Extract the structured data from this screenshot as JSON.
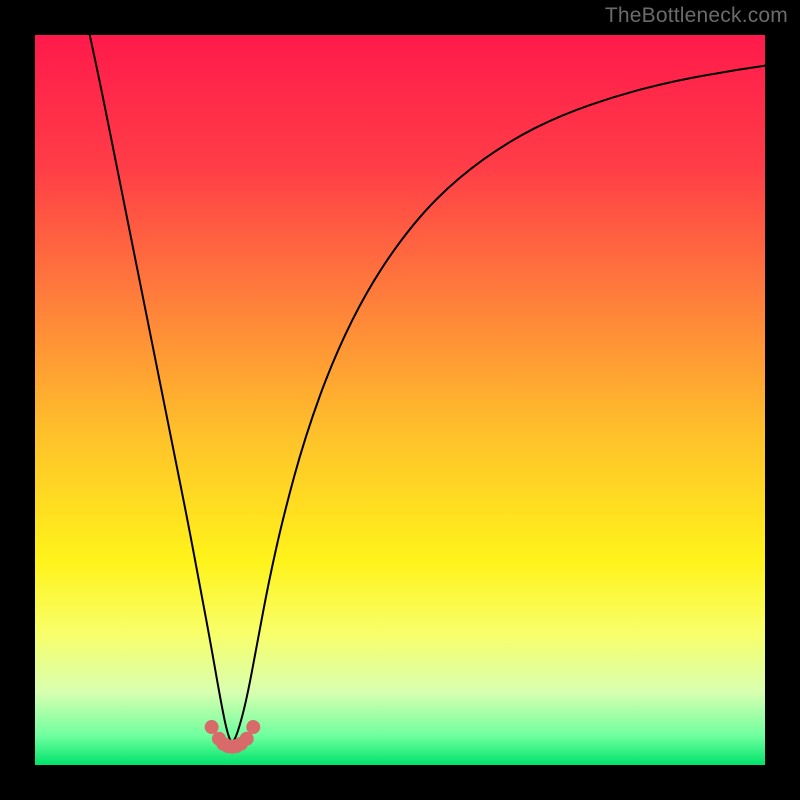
{
  "watermark": "TheBottleneck.com",
  "chart_data": {
    "type": "line",
    "title": "",
    "xlabel": "",
    "ylabel": "",
    "xlim": [
      0,
      100
    ],
    "ylim": [
      0,
      100
    ],
    "grid": false,
    "legend": false,
    "background_gradient": {
      "stops": [
        {
          "offset": 0.0,
          "color": "#ff1a4b"
        },
        {
          "offset": 0.18,
          "color": "#ff3d47"
        },
        {
          "offset": 0.35,
          "color": "#ff7a3c"
        },
        {
          "offset": 0.55,
          "color": "#ffc22a"
        },
        {
          "offset": 0.72,
          "color": "#fff31a"
        },
        {
          "offset": 0.82,
          "color": "#f8ff6a"
        },
        {
          "offset": 0.9,
          "color": "#d8ffb0"
        },
        {
          "offset": 0.96,
          "color": "#6fff9f"
        },
        {
          "offset": 1.0,
          "color": "#00e36b"
        }
      ]
    },
    "series": [
      {
        "name": "bottleneck-curve",
        "color": "#000000",
        "width": 2,
        "x": [
          7.5,
          9,
          11,
          13,
          15,
          17,
          19,
          21,
          22.5,
          24,
          25.4,
          26.3,
          27,
          27.8,
          29,
          30.5,
          32,
          34,
          37,
          41,
          46,
          52,
          58,
          65,
          72,
          80,
          88,
          96,
          100
        ],
        "y": [
          100,
          93,
          83,
          73,
          63,
          53,
          43,
          33,
          25,
          17,
          9,
          4.5,
          2.8,
          4.5,
          9,
          17,
          25,
          34,
          45,
          56,
          66,
          74.5,
          80.5,
          85.5,
          89,
          91.8,
          93.8,
          95.2,
          95.8
        ]
      },
      {
        "name": "highlight-dots",
        "color": "#d96a6a",
        "type": "scatter",
        "radius": 7,
        "x": [
          24.2,
          25.2,
          25.8,
          26.4,
          27.0,
          27.6,
          28.2,
          29.0,
          29.9
        ],
        "y": [
          5.2,
          3.6,
          2.9,
          2.6,
          2.5,
          2.6,
          2.9,
          3.6,
          5.2
        ]
      }
    ]
  }
}
